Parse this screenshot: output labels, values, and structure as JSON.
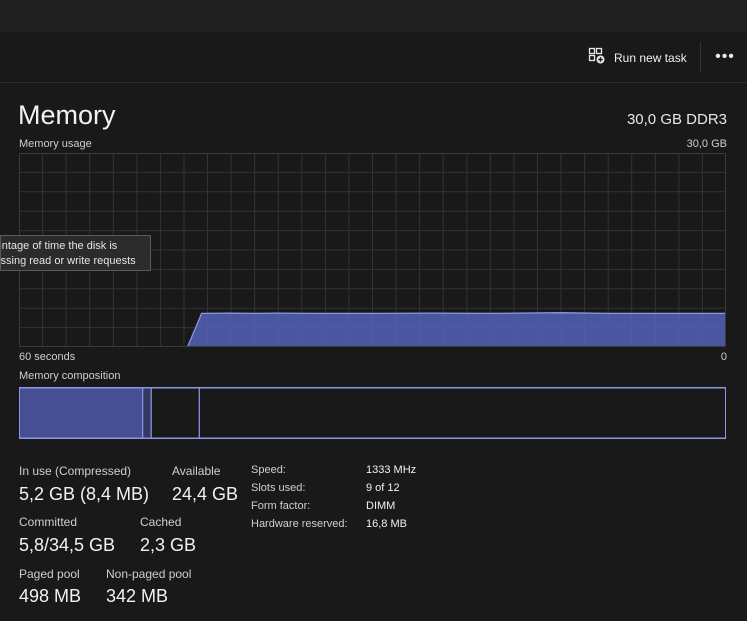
{
  "toolbar": {
    "run_new_task": "Run new task",
    "more": "•••"
  },
  "header": {
    "title": "Memory",
    "spec": "30,0 GB DDR3"
  },
  "graph": {
    "label": "Memory usage",
    "max_label": "30,0 GB",
    "left_axis": "60 seconds",
    "right_axis": "0"
  },
  "composition": {
    "label": "Memory composition"
  },
  "tooltip": {
    "line1": "Percentage of time the disk is",
    "line2": "processing read or write requests"
  },
  "stats": {
    "in_use_label": "In use (Compressed)",
    "in_use_value": "5,2 GB (8,4 MB)",
    "available_label": "Available",
    "available_value": "24,4 GB",
    "committed_label": "Committed",
    "committed_value": "5,8/34,5 GB",
    "cached_label": "Cached",
    "cached_value": "2,3 GB",
    "paged_label": "Paged pool",
    "paged_value": "498 MB",
    "nonpaged_label": "Non-paged pool",
    "nonpaged_value": "342 MB"
  },
  "info": {
    "speed_label": "Speed:",
    "speed_value": "1333 MHz",
    "slots_label": "Slots used:",
    "slots_value": "9 of 12",
    "form_label": "Form factor:",
    "form_value": "DIMM",
    "hw_label": "Hardware reserved:",
    "hw_value": "16,8 MB"
  },
  "chart_data": {
    "type": "area",
    "title": "Memory usage",
    "xlabel": "",
    "ylabel": "",
    "x_range": [
      60,
      0
    ],
    "ylim": [
      0,
      30
    ],
    "series": [
      {
        "x": [
          60,
          45.7,
          44.5,
          42,
          40,
          38,
          35,
          30,
          25,
          20,
          14,
          10,
          5,
          0
        ],
        "values": [
          0,
          0,
          5.2,
          5.25,
          5.2,
          5.25,
          5.2,
          5.2,
          5.25,
          5.2,
          5.3,
          5.2,
          5.2,
          5.2
        ]
      }
    ],
    "composition": [
      {
        "segment": "in-use",
        "fraction": 0.175
      },
      {
        "segment": "modified",
        "fraction": 0.012
      },
      {
        "segment": "standby",
        "fraction": 0.068
      },
      {
        "segment": "free",
        "fraction": 0.745
      }
    ],
    "colors": {
      "fill": "#5561b9",
      "line": "#8a95e8",
      "grid": "#333333",
      "border": "#8a95e8"
    }
  }
}
